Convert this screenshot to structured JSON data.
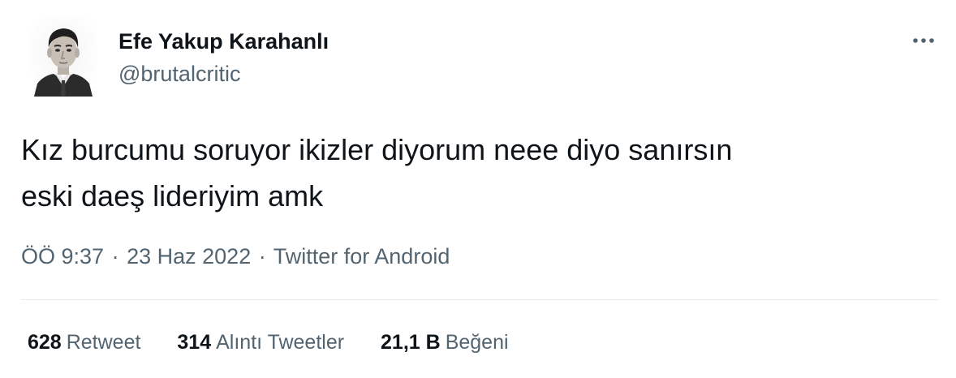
{
  "author": {
    "display_name": "Efe Yakup Karahanlı",
    "handle": "@brutalcritic"
  },
  "tweet": {
    "text": "Kız burcumu soruyor ikizler diyorum neee diyo sanırsın\neski daeş lideriyim amk"
  },
  "meta": {
    "time": "ÖÖ 9:37",
    "separator": "·",
    "date": "23 Haz 2022",
    "source": "Twitter for Android"
  },
  "stats": {
    "retweets_count": "628",
    "retweets_label": "Retweet",
    "quotes_count": "314",
    "quotes_label": "Alıntı Tweetler",
    "likes_count": "21,1 B",
    "likes_label": "Beğeni"
  },
  "icons": {
    "more": "more-horizontal-icon"
  },
  "colors": {
    "text_primary": "#0f1419",
    "text_secondary": "#536471",
    "divider": "#e6ecf0"
  }
}
